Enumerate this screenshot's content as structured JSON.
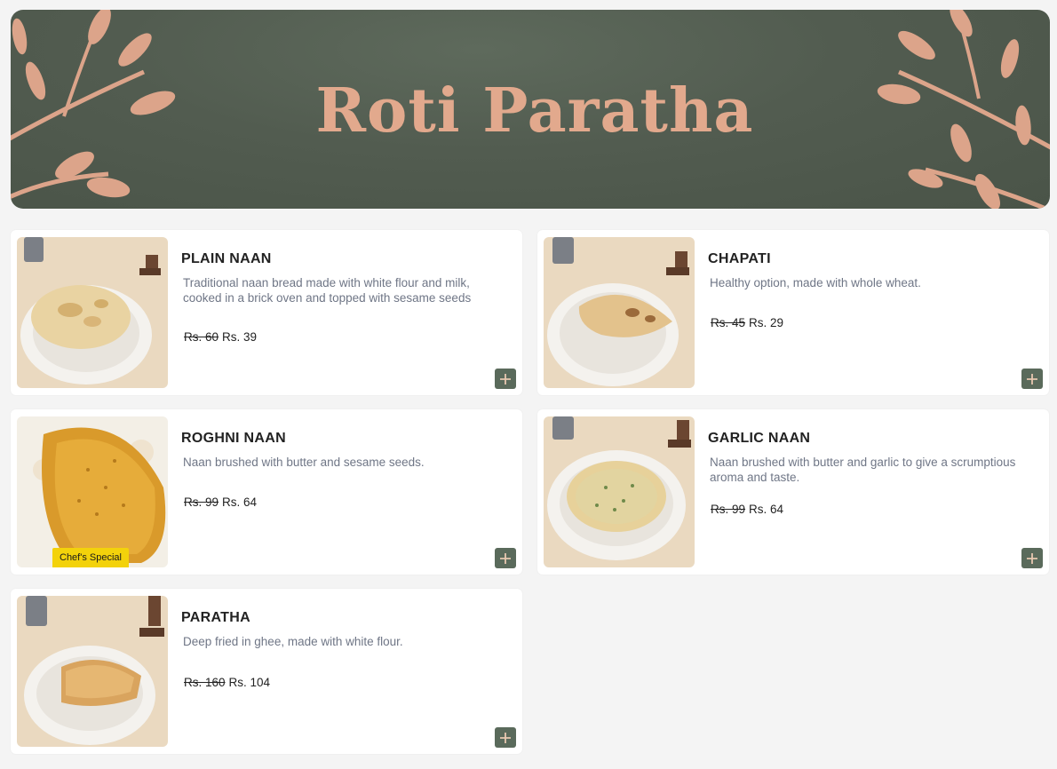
{
  "header": {
    "title": "Roti Paratha"
  },
  "colors": {
    "banner": "#525c50",
    "accent": "#e2a98d",
    "add_button": "#5a6a5b",
    "badge": "#f3d20b"
  },
  "menu": {
    "items": [
      {
        "name": "PLAIN NAAN",
        "description": "Traditional naan bread made with white flour and milk, cooked in a brick oven and topped with sesame seeds",
        "old_price": "Rs. 60",
        "price": "Rs. 39",
        "image": "plain-naan-photo"
      },
      {
        "name": "CHAPATI",
        "description": "Healthy option, made with whole wheat.",
        "old_price": "Rs. 45",
        "price": "Rs. 29",
        "image": "chapati-photo"
      },
      {
        "name": "ROGHNI NAAN",
        "description": "Naan brushed with butter and sesame seeds.",
        "old_price": "Rs. 99",
        "price": "Rs. 64",
        "image": "roghni-naan-photo",
        "badge": "Chef's Special"
      },
      {
        "name": "GARLIC NAAN",
        "description": "Naan brushed with butter and garlic to give a scrumptious aroma and taste.",
        "old_price": "Rs. 99",
        "price": "Rs. 64",
        "image": "garlic-naan-photo"
      },
      {
        "name": "PARATHA",
        "description": "Deep fried in ghee, made with white flour.",
        "old_price": "Rs. 160",
        "price": "Rs. 104",
        "image": "paratha-photo"
      }
    ]
  }
}
